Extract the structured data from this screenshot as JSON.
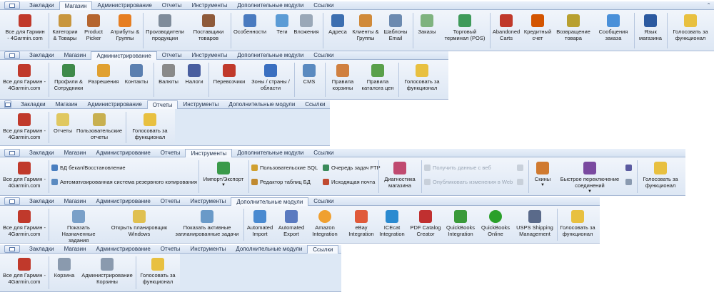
{
  "tabs": [
    "Закладки",
    "Магазин",
    "Администрирование",
    "Отчеты",
    "Инструменты",
    "Дополнительные модули",
    "Ссылки"
  ],
  "shop": {
    "items": [
      "Все для Гармин",
      "Категории & Товары",
      "Product Picker",
      "Атрибуты & Группы",
      "Производители продукции",
      "Поставщики товаров",
      "Особенности",
      "Теги",
      "Вложения",
      "Адреса",
      "Клиенты & Группы",
      "Шаблоны Email",
      "Заказы",
      "Торговый терминал (POS)",
      "Abandoned Carts",
      "Кредитный счет",
      "Возвращение товара",
      "Сообщения заказа",
      "Язык магазина",
      "Голосовать за функционал"
    ]
  },
  "admin": {
    "items": [
      "Все для Гармин - 4Garmin.com",
      "Профили & Сотрудники",
      "Разрешения",
      "Контакты",
      "Валюты",
      "Налоги",
      "Перевозчики",
      "Зоны / страны / области",
      "CMS",
      "Правила корзины",
      "Правила каталога цен",
      "Голосовать за функционал"
    ]
  },
  "reports": {
    "items": [
      "Все для Гармин - 4Garmin.com",
      "Отчеты",
      "Пользовательские отчеты",
      "Голосовать за функционал"
    ]
  },
  "tools": {
    "big": [
      "Все для Гармин - 4Garmin.com",
      "Импорт/Экспорт",
      "Диагностика магазина",
      "Скины",
      "Быстрое переключение соединений",
      "Голосовать за функционал"
    ],
    "small": [
      "БД бекап/Восстановление",
      "Автоматизированная система резервного копирования",
      "Пользовательские SQL",
      "Редактор таблиц БД",
      "Очередь задач FTP",
      "Исходящая почта",
      "Получить данные с веб",
      "Опубликовать изменения в Web"
    ]
  },
  "modules": {
    "items": [
      "Все для Гармин - 4Garmin.com",
      "Показать Назначенные задания",
      "Открыть планировщик Windows",
      "Показать активные запланированные задачи",
      "Automated Import",
      "Automated Export",
      "Amazon Integration",
      "eBay Integration",
      "ICEcat Integration",
      "PDF Catalog Creator",
      "QuickBooks Integration",
      "QuickBooks Online",
      "USPS Shipping Management",
      "Голосовать за функционал"
    ]
  },
  "links": {
    "items": [
      "Все для Гармин - 4Garmin.com",
      "Корзина",
      "Администрирование Корзины",
      "Голосовать за функционал"
    ]
  },
  "shop_second_line": "- 4Garmin.com",
  "corner_icon": "expand-icon"
}
